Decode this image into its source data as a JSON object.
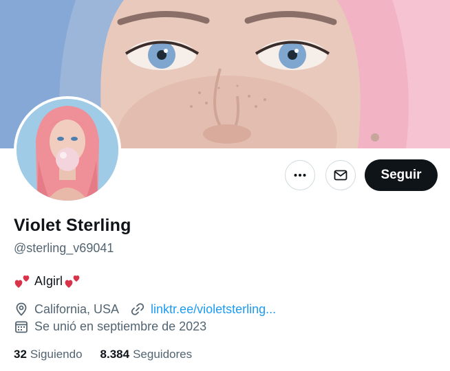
{
  "profile": {
    "display_name": "Violet Sterling",
    "handle": "@sterling_v69041",
    "bio_text": "AIgirl",
    "location": "California, USA",
    "link": "linktr.ee/violetsterling...",
    "joined": "Se unió en septiembre de 2023"
  },
  "actions": {
    "follow_label": "Seguir",
    "more_icon": "more-horizontal-icon",
    "message_icon": "envelope-icon"
  },
  "stats": {
    "following_count": "32",
    "following_label": "Siguiendo",
    "followers_count": "8.384",
    "followers_label": "Seguidores"
  },
  "colors": {
    "accent_link": "#1d9bf0",
    "follow_button": "#0f1419",
    "secondary_text": "#536471"
  }
}
